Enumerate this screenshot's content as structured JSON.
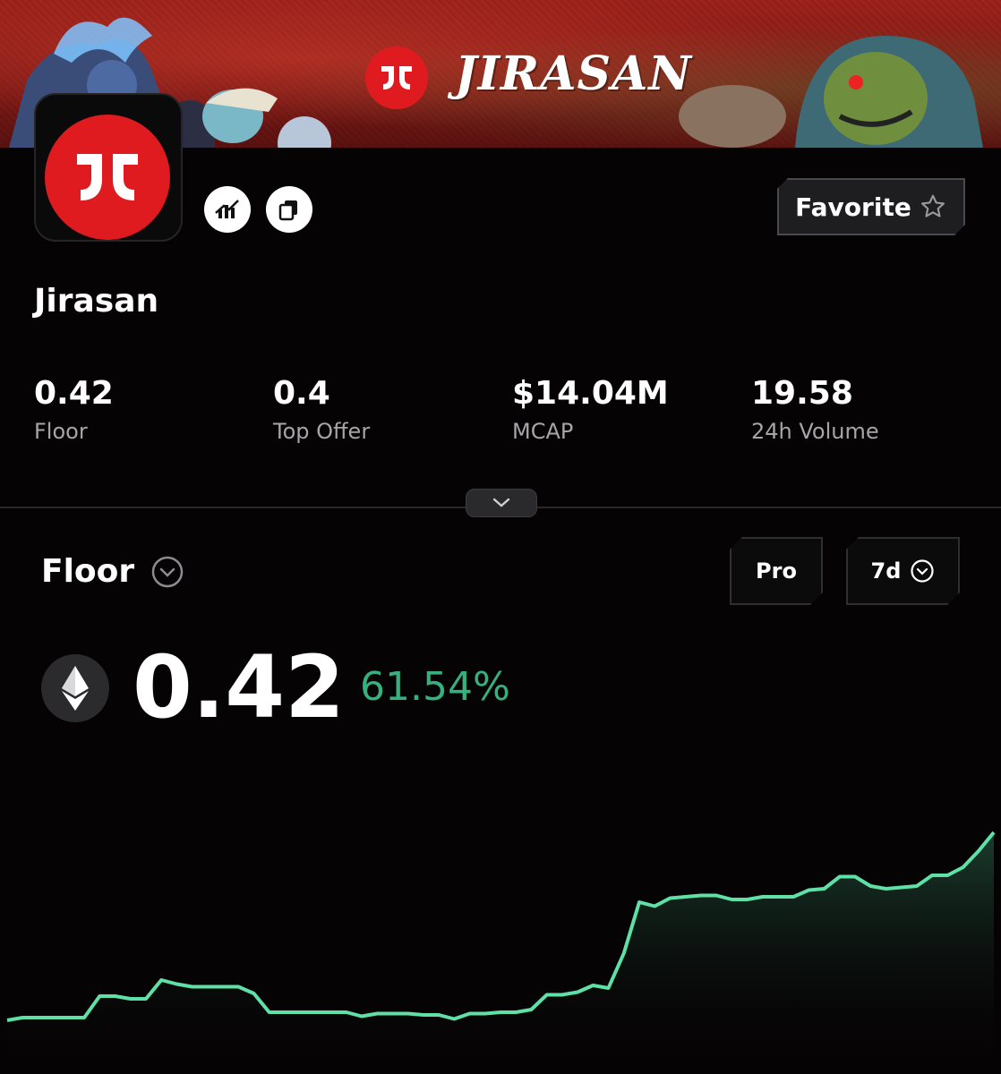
{
  "banner": {
    "title": "JIRASAN"
  },
  "collection": {
    "name": "Jirasan"
  },
  "buttons": {
    "favorite_label": "Favorite"
  },
  "stats": [
    {
      "value": "0.42",
      "label": "Floor"
    },
    {
      "value": "0.4",
      "label": "Top Offer"
    },
    {
      "value": "$14.04M",
      "label": "MCAP"
    },
    {
      "value": "19.58",
      "label": "24h Volume"
    }
  ],
  "chart_section": {
    "metric_label": "Floor",
    "pro_label": "Pro",
    "range_label": "7d",
    "current_value": "0.42",
    "change_percent": "61.54%"
  },
  "colors": {
    "accent_green": "#35b07e",
    "line_green": "#5fe0a6",
    "brand_red": "#e01b1f"
  },
  "icons": [
    "stats-icon",
    "copy-icon",
    "star-icon",
    "chevron-down-icon",
    "eth-icon"
  ],
  "chart_data": {
    "type": "area",
    "title": "",
    "xlabel": "",
    "ylabel": "",
    "x": [
      0,
      1,
      2,
      3,
      4,
      5,
      6,
      7,
      8,
      9,
      10,
      11,
      12,
      13,
      14,
      15,
      16,
      17,
      18,
      19,
      20,
      21,
      22,
      23,
      24,
      25,
      26,
      27,
      28,
      29,
      30,
      31,
      32,
      33,
      34,
      35,
      36,
      37,
      38,
      39,
      40,
      41,
      42,
      43,
      44,
      45,
      46,
      47,
      48,
      49,
      50,
      51,
      52,
      53,
      54,
      55,
      56,
      57,
      58,
      59,
      60,
      61,
      62,
      63,
      64
    ],
    "series": [
      {
        "values": [
          0.26,
          0.262,
          0.262,
          0.262,
          0.262,
          0.262,
          0.278,
          0.278,
          0.276,
          0.276,
          0.29,
          0.287,
          0.285,
          0.285,
          0.285,
          0.285,
          0.28,
          0.266,
          0.266,
          0.266,
          0.266,
          0.266,
          0.266,
          0.263,
          0.265,
          0.265,
          0.265,
          0.264,
          0.264,
          0.261,
          0.265,
          0.265,
          0.266,
          0.266,
          0.268,
          0.279,
          0.279,
          0.281,
          0.286,
          0.284,
          0.31,
          0.348,
          0.345,
          0.351,
          0.352,
          0.353,
          0.353,
          0.35,
          0.35,
          0.352,
          0.352,
          0.352,
          0.357,
          0.358,
          0.367,
          0.367,
          0.36,
          0.358,
          0.359,
          0.36,
          0.368,
          0.368,
          0.374,
          0.386,
          0.4
        ]
      }
    ],
    "ylim": [
      0.22,
      0.42
    ],
    "grid": false,
    "legend": "none"
  }
}
